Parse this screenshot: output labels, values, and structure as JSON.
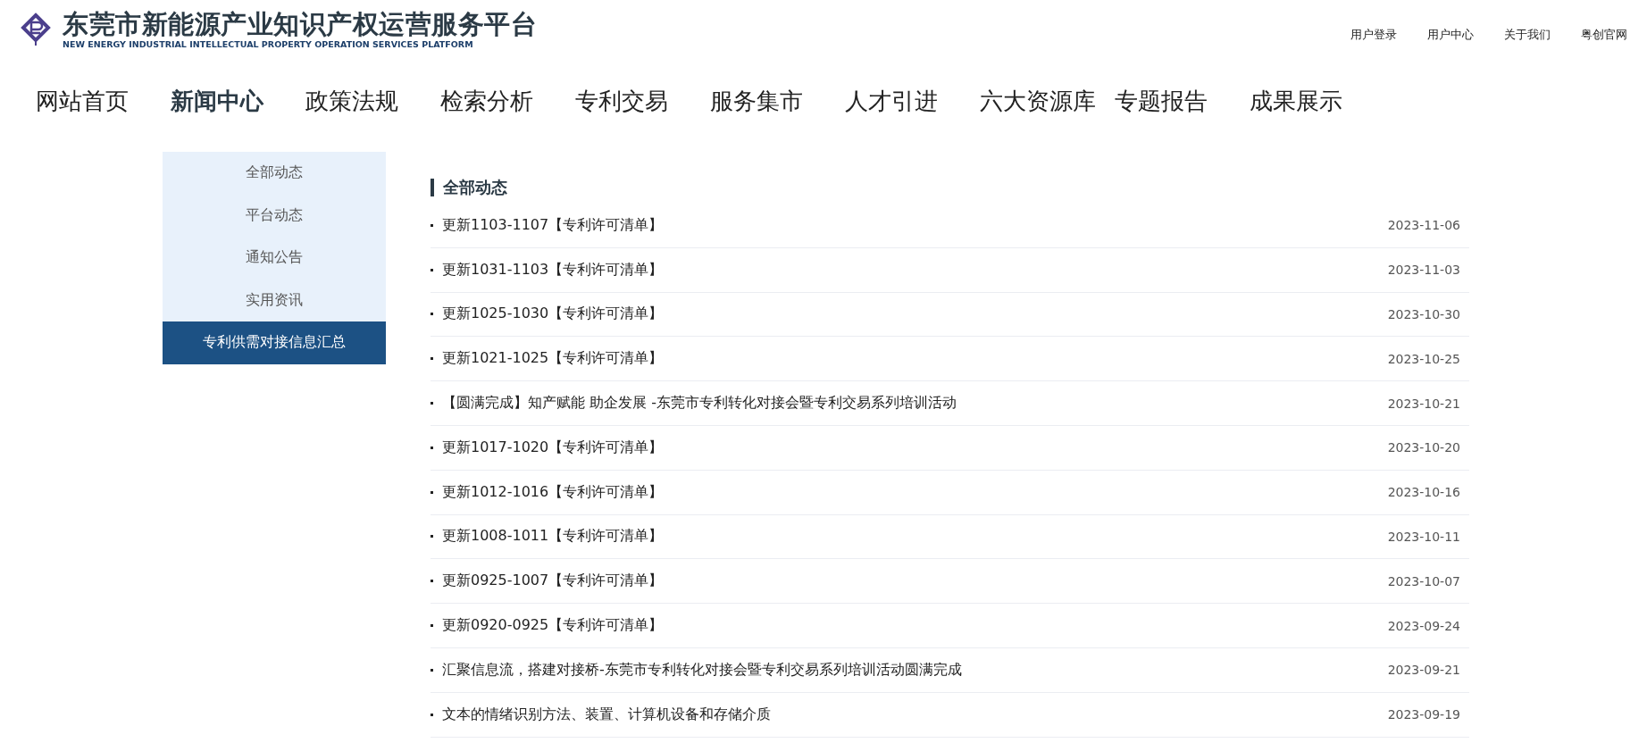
{
  "header": {
    "title": "东莞市新能源产业知识产权运营服务平台",
    "subtitle": "NEW ENERGY INDUSTRIAL INTELLECTUAL PROPERTY OPERATION SERVICES PLATFORM",
    "links": [
      "用户登录",
      "用户中心",
      "关于我们",
      "粤创官网"
    ]
  },
  "nav": [
    {
      "label": "网站首页",
      "selected": false
    },
    {
      "label": "新闻中心",
      "selected": true
    },
    {
      "label": "政策法规",
      "selected": false
    },
    {
      "label": "检索分析",
      "selected": false
    },
    {
      "label": "专利交易",
      "selected": false
    },
    {
      "label": "服务集市",
      "selected": false
    },
    {
      "label": "人才引进",
      "selected": false
    },
    {
      "label": "六大资源库",
      "selected": false
    },
    {
      "label": "专题报告",
      "selected": false
    },
    {
      "label": "成果展示",
      "selected": false
    }
  ],
  "sidebar": {
    "items": [
      {
        "label": "全部动态",
        "selected": false
      },
      {
        "label": "平台动态",
        "selected": false
      },
      {
        "label": "通知公告",
        "selected": false
      },
      {
        "label": "实用资讯",
        "selected": false
      },
      {
        "label": "专利供需对接信息汇总",
        "selected": true
      }
    ]
  },
  "content": {
    "heading": "全部动态",
    "rows": [
      {
        "title": "更新1103-1107【专利许可清单】",
        "date": "2023-11-06"
      },
      {
        "title": "更新1031-1103【专利许可清单】",
        "date": "2023-11-03"
      },
      {
        "title": "更新1025-1030【专利许可清单】",
        "date": "2023-10-30"
      },
      {
        "title": "更新1021-1025【专利许可清单】",
        "date": "2023-10-25"
      },
      {
        "title": "【圆满完成】知产赋能 助企发展 -东莞市专利转化对接会暨专利交易系列培训活动",
        "date": "2023-10-21"
      },
      {
        "title": "更新1017-1020【专利许可清单】",
        "date": "2023-10-20"
      },
      {
        "title": "更新1012-1016【专利许可清单】",
        "date": "2023-10-16"
      },
      {
        "title": "更新1008-1011【专利许可清单】",
        "date": "2023-10-11"
      },
      {
        "title": "更新0925-1007【专利许可清单】",
        "date": "2023-10-07"
      },
      {
        "title": "更新0920-0925【专利许可清单】",
        "date": "2023-09-24"
      },
      {
        "title": "汇聚信息流，搭建对接桥-东莞市专利转化对接会暨专利交易系列培训活动圆满完成",
        "date": "2023-09-21"
      },
      {
        "title": "文本的情绪识别方法、装置、计算机设备和存储介质",
        "date": "2023-09-19"
      }
    ]
  }
}
